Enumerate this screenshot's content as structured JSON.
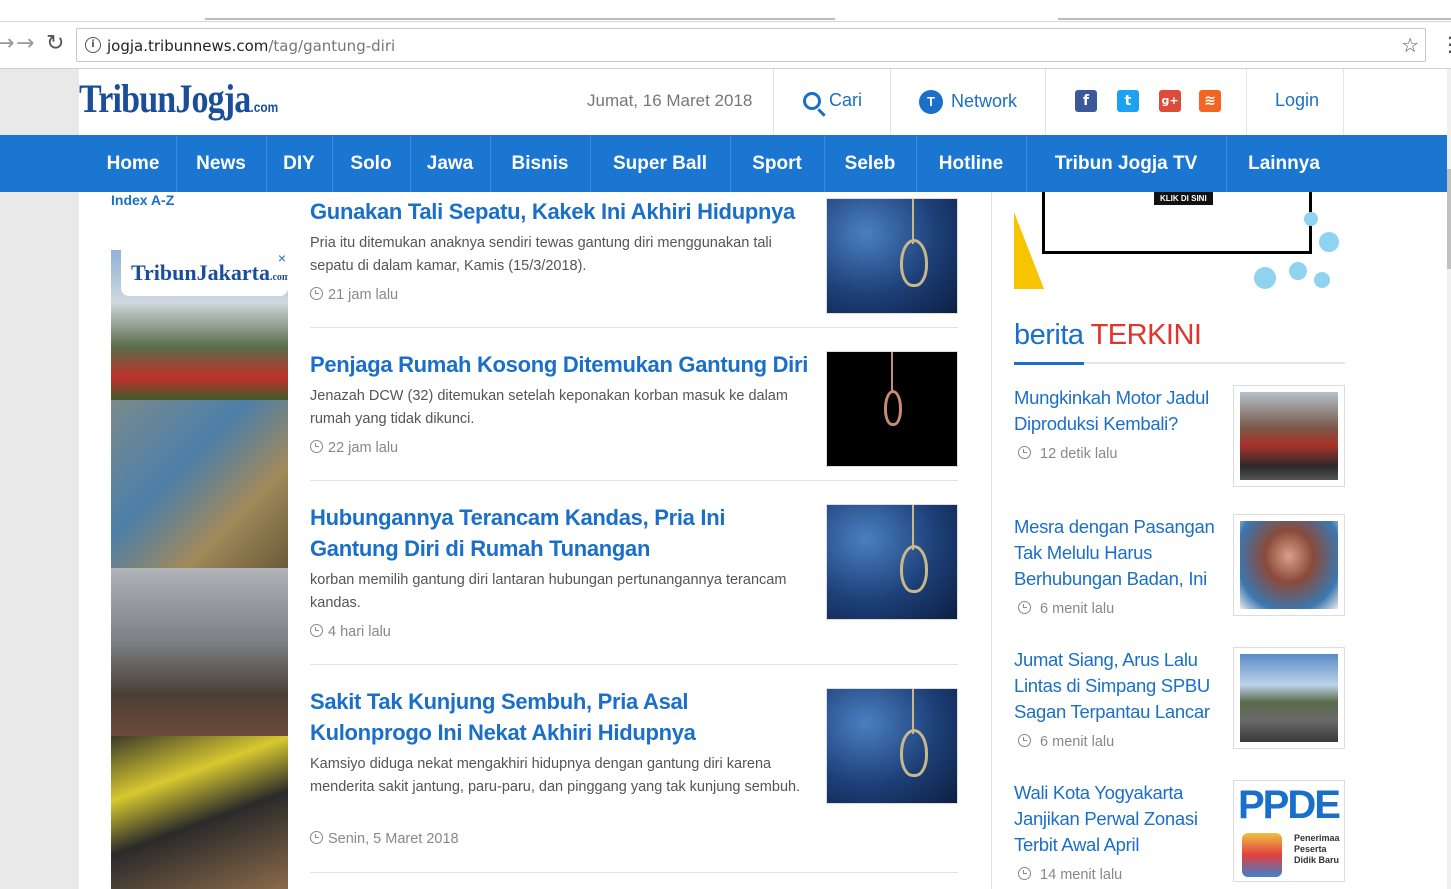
{
  "browser": {
    "url_host": "jogja.tribunnews.com",
    "url_path": "/tag/gantung-diri"
  },
  "header": {
    "logo_text": "TribunJogja",
    "logo_suffix": ".com",
    "date": "Jumat, 16 Maret 2018",
    "search_label": "Cari",
    "network_label": "Network",
    "login_label": "Login",
    "social": [
      {
        "name": "facebook",
        "glyph": "f",
        "color": "#3b5998"
      },
      {
        "name": "twitter",
        "glyph": "t",
        "color": "#1da1f2"
      },
      {
        "name": "google-plus",
        "glyph": "g+",
        "color": "#dd4b39"
      },
      {
        "name": "rss",
        "glyph": "≋",
        "color": "#f26522"
      }
    ]
  },
  "nav": {
    "items": [
      "Home",
      "News",
      "DIY",
      "Solo",
      "Jawa",
      "Bisnis",
      "Super Ball",
      "Sport",
      "Seleb",
      "Hotline",
      "Tribun Jogja TV",
      "Lainnya"
    ]
  },
  "left": {
    "index_label": "Index A-Z",
    "ad_logo": "TribunJakarta",
    "ad_logo_suffix": ".com",
    "ad_close": "×"
  },
  "articles": [
    {
      "title": "Gunakan Tali Sepatu, Kakek Ini Akhiri Hidupnya",
      "desc": "Pria itu ditemukan anaknya sendiri tewas gantung diri menggunakan tali sepatu di dalam kamar, Kamis (15/3/2018).",
      "time": "21 jam lalu"
    },
    {
      "title": "Penjaga Rumah Kosong Ditemukan Gantung Diri",
      "desc": "Jenazah DCW (32) ditemukan setelah keponakan korban masuk ke dalam rumah yang tidak dikunci.",
      "time": "22 jam lalu"
    },
    {
      "title": "Hubungannya Terancam Kandas, Pria Ini Gantung Diri di Rumah Tunangan",
      "desc": "korban memilih gantung diri lantaran hubungan pertunangannya terancam kandas.",
      "time": "4 hari lalu"
    },
    {
      "title": "Sakit Tak Kunjung Sembuh, Pria Asal Kulonprogo Ini Nekat Akhiri Hidupnya",
      "desc": "Kamsiyo diduga nekat mengakhiri hidupnya dengan gantung diri karena menderita sakit jantung, paru-paru, dan pinggang yang tak kunjung sembuh.",
      "time": "Senin, 5 Maret 2018"
    }
  ],
  "sidebar": {
    "ad_klik": "KLIK DI SINI",
    "terkini_prefix": "berita ",
    "terkini_highlight": "TERKINI",
    "news": [
      {
        "title": "Mungkinkah Motor Jadul Diproduksi Kembali?",
        "time": "12 detik lalu"
      },
      {
        "title": "Mesra dengan Pasangan Tak Melulu Harus Berhubungan Badan, Ini",
        "time": "6 menit lalu"
      },
      {
        "title": "Jumat Siang, Arus Lalu Lintas di Simpang SPBU Sagan Terpantau Lancar",
        "time": "6 menit lalu"
      },
      {
        "title": "Wali Kota Yogyakarta Janjikan Perwal Zonasi Terbit Awal April",
        "time": "14 menit lalu"
      }
    ],
    "ppdb_big": "PPDE",
    "ppdb_small": "Penerimaa Peserta Didik Baru"
  }
}
